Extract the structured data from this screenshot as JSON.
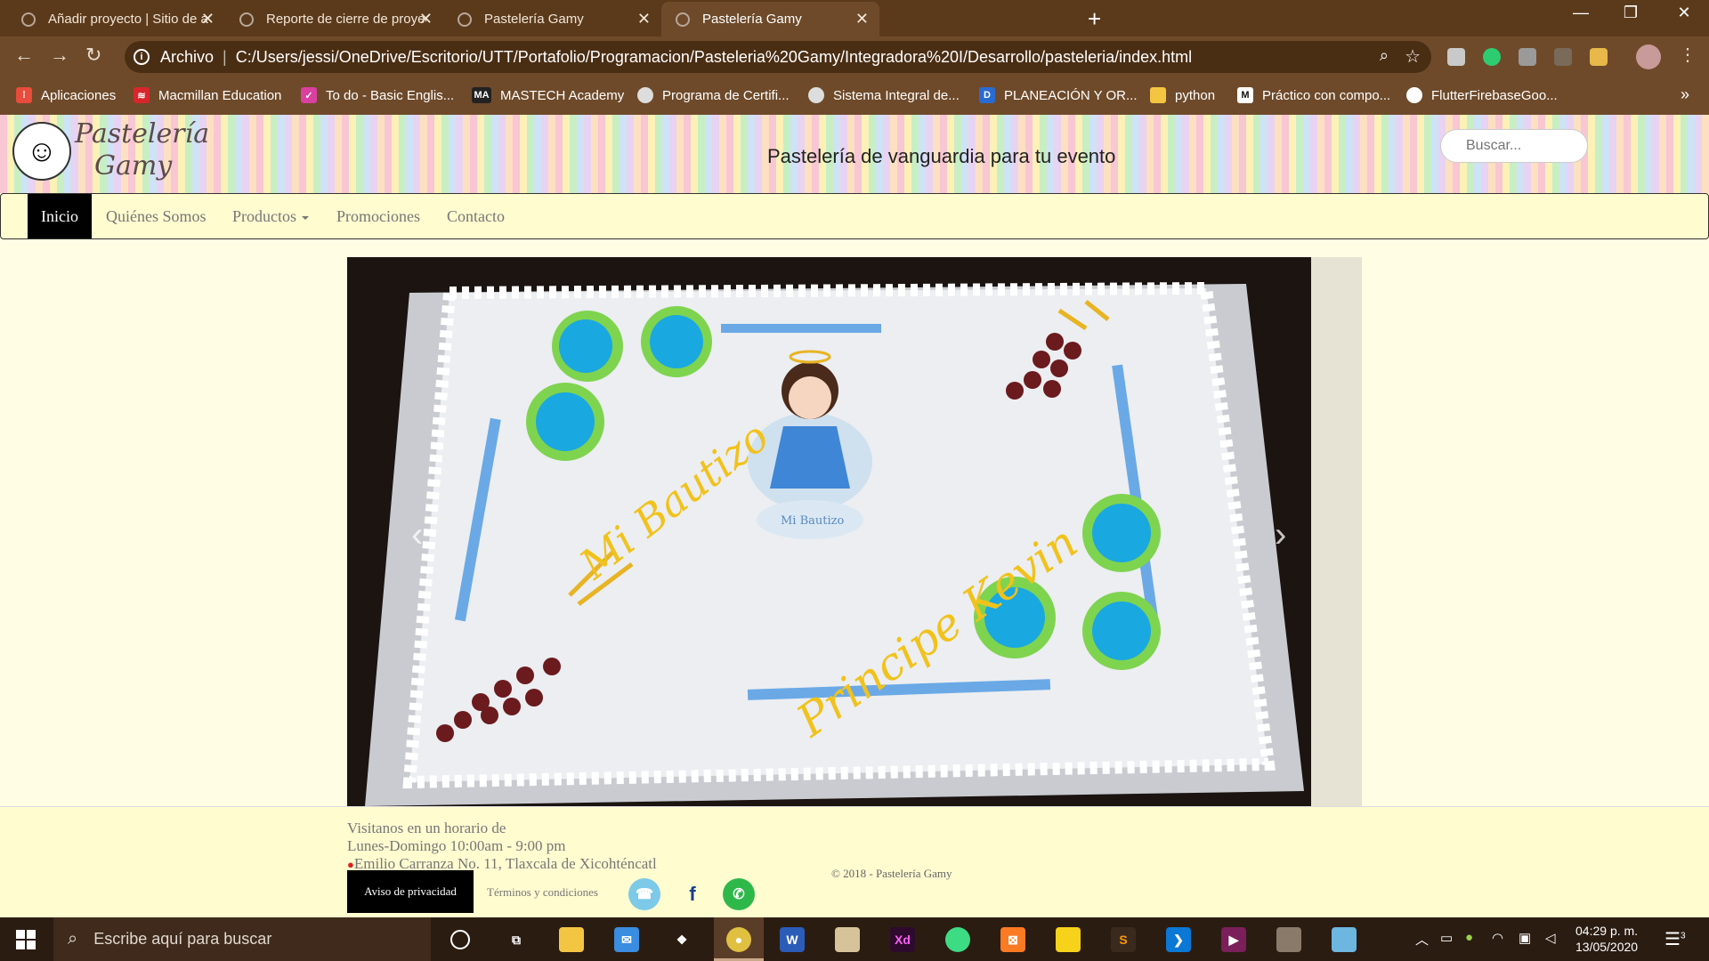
{
  "browser": {
    "tabs": [
      {
        "title": "Añadir proyecto | Sitio de admini",
        "active": false
      },
      {
        "title": "Reporte de cierre de proyecto.pd",
        "active": false
      },
      {
        "title": "Pastelería Gamy",
        "active": false
      },
      {
        "title": "Pastelería Gamy",
        "active": true
      }
    ],
    "new_tab": "+",
    "window_controls": {
      "minimize": "—",
      "restore": "❐",
      "close": "✕"
    },
    "address": {
      "scheme_label": "Archivo",
      "separator": "|",
      "url": "C:/Users/jessi/OneDrive/Escritorio/UTT/Portafolio/Programacion/Pasteleria%20Gamy/Integradora%20I/Desarrollo/pasteleria/index.html"
    },
    "bookmarks": [
      {
        "label": "Aplicaciones",
        "icon": "apps-grid-icon",
        "color": "#e74c3c"
      },
      {
        "label": "Macmillan Education",
        "icon": "macmillan-icon",
        "color": "#d9262c"
      },
      {
        "label": "To do - Basic Englis...",
        "icon": "todo-icon",
        "color": "#d940a0"
      },
      {
        "label": "MASTECH Academy",
        "icon": "mastech-icon",
        "color": "#222222"
      },
      {
        "label": "Programa de Certifi...",
        "icon": "globe-icon",
        "color": "#dddddd"
      },
      {
        "label": "Sistema Integral de...",
        "icon": "globe-icon",
        "color": "#dddddd"
      },
      {
        "label": "PLANEACIÓN Y OR...",
        "icon": "doc-d-icon",
        "color": "#2a6bd1"
      },
      {
        "label": "python",
        "icon": "folder-icon",
        "color": "#f4c542"
      },
      {
        "label": "Práctico con compo...",
        "icon": "medium-icon",
        "color": "#111111"
      },
      {
        "label": "FlutterFirebaseGoo...",
        "icon": "github-icon",
        "color": "#ffffff"
      }
    ],
    "bookmarks_more": "»"
  },
  "site": {
    "logo_line1": "Pastelería",
    "logo_line2": "Gamy",
    "tagline": "Pastelería de vanguardia para tu evento",
    "search_placeholder": "Buscar...",
    "nav": [
      {
        "label": "Inicio",
        "active": true
      },
      {
        "label": "Quiénes Somos",
        "active": false
      },
      {
        "label": "Productos",
        "active": false,
        "dropdown": true
      },
      {
        "label": "Promociones",
        "active": false
      },
      {
        "label": "Contacto",
        "active": false
      }
    ],
    "carousel": {
      "slide_alt": "Pastel de bautizo con rosas azules y uvas",
      "cake_text_1": "Mi Bautizo",
      "cake_text_2": "Principe Kevin",
      "topper_text": "Mi Bautizo",
      "prev": "‹",
      "next": "›"
    },
    "footer": {
      "line1": "Visitanos en un horario de",
      "line2": "Lunes-Domingo 10:00am - 9:00 pm",
      "line3": "Emilio Carranza No. 11, Tlaxcala de Xicohténcatl",
      "copyright": "© 2018 - Pastelería Gamy",
      "privacy": "Aviso de privacidad",
      "terms": "Términos y condiciones"
    }
  },
  "taskbar": {
    "search_placeholder": "Escribe aquí para buscar",
    "time": "04:29 p. m.",
    "date": "13/05/2020",
    "notifications": "3"
  },
  "colors": {
    "chrome": "#5b3a1b",
    "page_bg": "#fffde3",
    "nav_bg": "#fffcd0",
    "active_nav": "#000000"
  }
}
